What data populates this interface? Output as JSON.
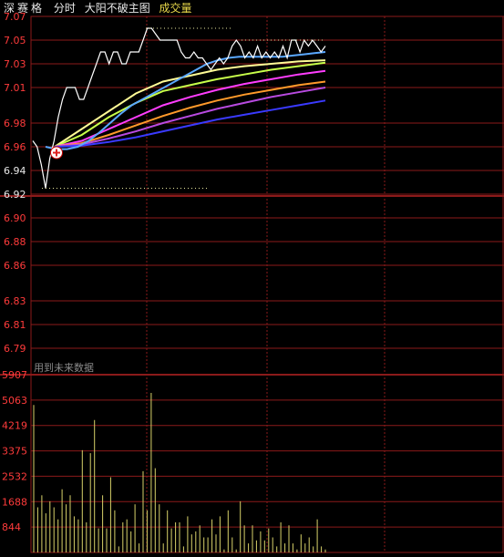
{
  "header": {
    "stock_name": "深赛格",
    "tab_intraday": "分时",
    "indicator_name": "大阳不破主图",
    "volume_label": "成交量"
  },
  "price_axis": {
    "ticks": [
      "7.07",
      "7.05",
      "7.03",
      "7.01",
      "6.98",
      "6.96",
      "6.94",
      "6.92",
      "6.90",
      "6.88",
      "6.86",
      "6.83",
      "6.81",
      "6.79"
    ],
    "color_up": "#ff3b3b",
    "color_ref": "#e8e8e8",
    "color_down": "#2ccd2c"
  },
  "volume_axis": {
    "ticks": [
      "5907",
      "5063",
      "4219",
      "3375",
      "2532",
      "1688",
      "844"
    ]
  },
  "future_note": "用到未来数据",
  "colors": {
    "grid": "#8b1a1a",
    "price_line": "#ffffff",
    "avg_line": "#5aa8ff",
    "volume_bar": "#d8d26a",
    "dotted": "#e8e8a0",
    "marker": "#e02020"
  },
  "chart_data": {
    "type": "line",
    "price_series": [
      6.965,
      6.96,
      6.945,
      6.925,
      6.95,
      6.965,
      6.985,
      7.0,
      7.01,
      7.01,
      7.01,
      7.0,
      7.0,
      7.01,
      7.02,
      7.03,
      7.04,
      7.04,
      7.03,
      7.04,
      7.04,
      7.03,
      7.03,
      7.04,
      7.04,
      7.04,
      7.05,
      7.06,
      7.06,
      7.055,
      7.05,
      7.05,
      7.05,
      7.05,
      7.05,
      7.04,
      7.035,
      7.035,
      7.04,
      7.035,
      7.035,
      7.03,
      7.025,
      7.03,
      7.035,
      7.03,
      7.035,
      7.045,
      7.05,
      7.045,
      7.035,
      7.04,
      7.035,
      7.045,
      7.035,
      7.04,
      7.035,
      7.04,
      7.035,
      7.045,
      7.035,
      7.05,
      7.05,
      7.04,
      7.05,
      7.045,
      7.05,
      7.045,
      7.04,
      7.045
    ],
    "avg_series": [
      6.96,
      6.958,
      6.958,
      6.96,
      6.965,
      6.972,
      6.98,
      6.988,
      6.995,
      7.0,
      7.005,
      7.01,
      7.015,
      7.02,
      7.025,
      7.03,
      7.033,
      7.035,
      7.036,
      7.036,
      7.036,
      7.036,
      7.036,
      7.037,
      7.038,
      7.039,
      7.04
    ],
    "ma_series": [
      {
        "color": "#fffb96",
        "values": [
          6.96,
          6.975,
          6.99,
          7.005,
          7.015,
          7.02,
          7.025,
          7.028,
          7.03,
          7.032,
          7.033
        ]
      },
      {
        "color": "#c8ff4a",
        "values": [
          6.96,
          6.97,
          6.985,
          6.997,
          7.007,
          7.012,
          7.017,
          7.021,
          7.025,
          7.028,
          7.031
        ]
      },
      {
        "color": "#ff3dff",
        "values": [
          6.96,
          6.965,
          6.975,
          6.985,
          6.995,
          7.002,
          7.008,
          7.013,
          7.017,
          7.021,
          7.024
        ]
      },
      {
        "color": "#ff9a2a",
        "values": [
          6.96,
          6.963,
          6.97,
          6.978,
          6.986,
          6.993,
          6.999,
          7.004,
          7.008,
          7.012,
          7.015
        ]
      },
      {
        "color": "#b84ae0",
        "values": [
          6.96,
          6.962,
          6.967,
          6.973,
          6.98,
          6.986,
          6.992,
          6.997,
          7.002,
          7.006,
          7.01
        ]
      },
      {
        "color": "#3a3aff",
        "values": [
          6.96,
          6.961,
          6.964,
          6.968,
          6.973,
          6.978,
          6.983,
          6.987,
          6.991,
          6.995,
          6.999
        ]
      }
    ],
    "volume": [
      4900,
      1500,
      1900,
      1300,
      1700,
      1500,
      1100,
      2100,
      1600,
      1900,
      1200,
      1100,
      3400,
      1000,
      3300,
      4400,
      800,
      1900,
      800,
      2500,
      1400,
      200,
      1000,
      1100,
      700,
      1600,
      300,
      2700,
      1400,
      5300,
      2800,
      1600,
      300,
      1400,
      800,
      1000,
      1000,
      200,
      1200,
      600,
      700,
      900,
      500,
      500,
      1100,
      600,
      1200,
      100,
      1400,
      500,
      100,
      1700,
      900,
      300,
      900,
      400,
      700,
      400,
      800,
      500,
      200,
      1000,
      300,
      900,
      300,
      100,
      600,
      300,
      500,
      200,
      1100,
      200,
      100
    ]
  }
}
